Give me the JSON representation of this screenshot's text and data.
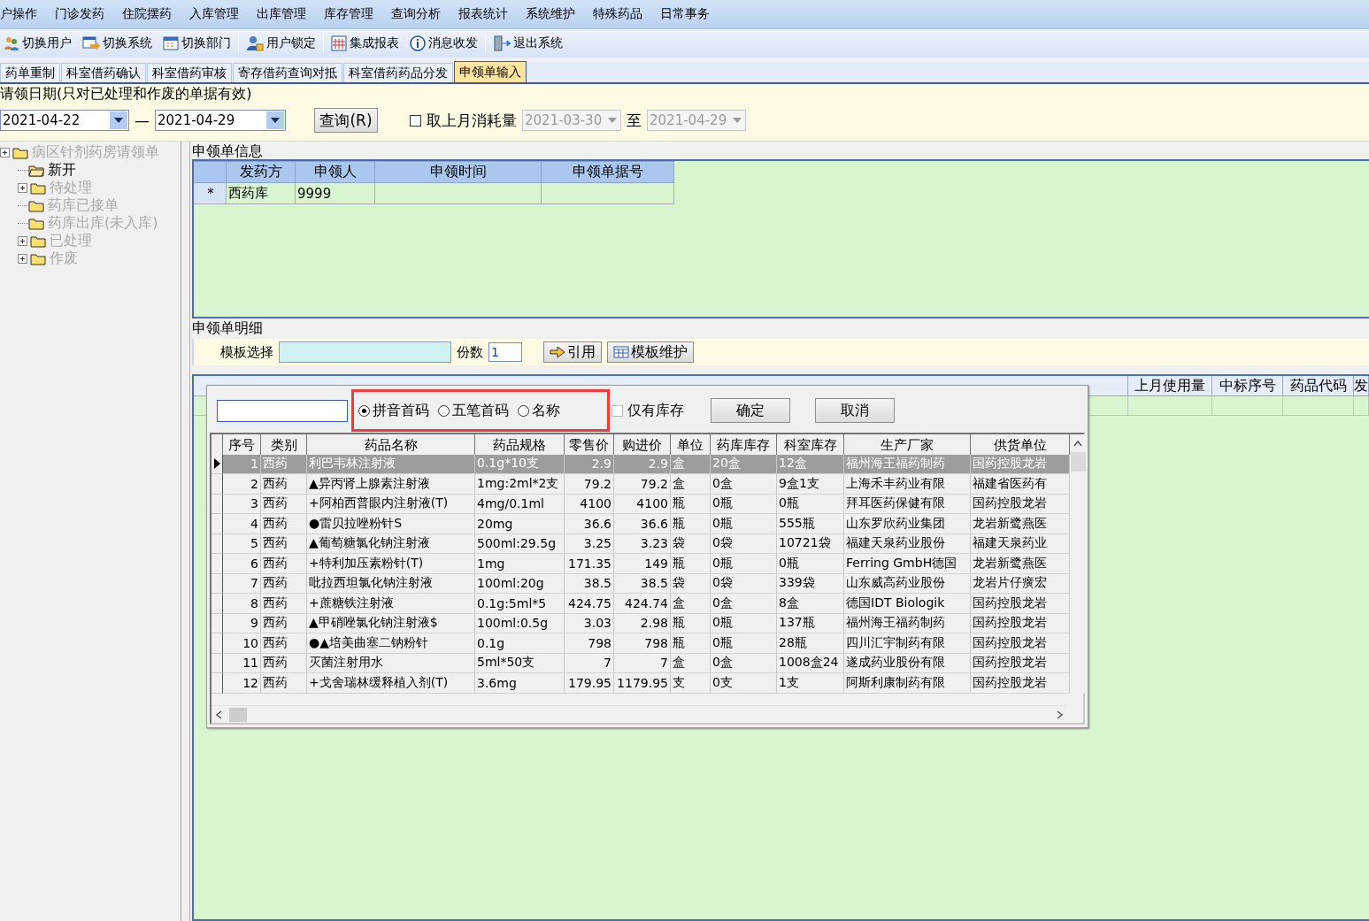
{
  "menu": [
    "户操作",
    "门诊发药",
    "住院摆药",
    "入库管理",
    "出库管理",
    "库存管理",
    "查询分析",
    "报表统计",
    "系统维护",
    "特殊药品",
    "日常事务"
  ],
  "toolbar": [
    "切换用户",
    "切换系统",
    "切换部门",
    "用户锁定",
    "集成报表",
    "消息收发",
    "退出系统"
  ],
  "tabs": [
    {
      "label": "药单重制",
      "selected": false
    },
    {
      "label": "科室借药确认",
      "selected": false
    },
    {
      "label": "科室借药审核",
      "selected": false
    },
    {
      "label": "寄存借药查询对抵",
      "selected": false
    },
    {
      "label": "科室借药药品分发",
      "selected": false
    },
    {
      "label": "申领单输入",
      "selected": true
    }
  ],
  "date_filter": {
    "label": "请领日期(只对已处理和作废的单据有效)",
    "from": "2021-04-22",
    "dash": "—",
    "to": "2021-04-29",
    "query_button": "查询(R)",
    "last_month": {
      "label": "取上月消耗量",
      "checked": false,
      "from": "2021-03-30",
      "to_label": "至",
      "to": "2021-04-29"
    }
  },
  "tree": {
    "label": "病区针剂药房请领单",
    "selected": false,
    "expandable": true,
    "children": [
      {
        "label": "新开",
        "selected": true,
        "expandable": false
      },
      {
        "label": "待处理",
        "selected": false,
        "expandable": true
      },
      {
        "label": "药库已接单",
        "selected": false,
        "expandable": false
      },
      {
        "label": "药库出库(未入库)",
        "selected": false,
        "expandable": false
      },
      {
        "label": "已处理",
        "selected": false,
        "expandable": true
      },
      {
        "label": "作废",
        "selected": false,
        "expandable": true
      }
    ]
  },
  "order_info": {
    "title": "申领单信息",
    "columns": [
      "发药方",
      "申领人",
      "申领时间",
      "申领单据号"
    ],
    "rows": [
      {
        "marker": "*",
        "cells": [
          "西药库",
          "9999"
        ]
      }
    ]
  },
  "detail": {
    "title": "申领单明细",
    "template_label": "模板选择",
    "copies_label": "份数",
    "copies": "1",
    "buttons": [
      "引用",
      "模板维护"
    ],
    "grid_columns": [
      "上月使用量",
      "中标序号",
      "药品代码",
      "发"
    ]
  },
  "picker": {
    "modes": [
      {
        "label": "拼音首码",
        "selected": true
      },
      {
        "label": "五笔首码",
        "selected": false
      },
      {
        "label": "名称",
        "selected": false
      }
    ],
    "in_stock": {
      "label": "仅有库存",
      "checked": false
    },
    "buttons": [
      "确定",
      "取消"
    ],
    "columns": [
      "序号",
      "类别",
      "药品名称",
      "药品规格",
      "零售价",
      "购进价",
      "单位",
      "药库库存",
      "科室库存",
      "生产厂家",
      "供货单位"
    ],
    "rows": [
      {
        "selected": true,
        "cells": [
          "1",
          "西药",
          "利巴韦林注射液",
          "0.1g*10支",
          "2.9",
          "2.9",
          "盒",
          "20盒",
          "12盒",
          "福州海王福药制药",
          "国药控股龙岩"
        ]
      },
      {
        "selected": false,
        "cells": [
          "2",
          "西药",
          "▲异丙肾上腺素注射液",
          "1mg:2ml*2支",
          "79.2",
          "79.2",
          "盒",
          "0盒",
          "9盒1支",
          "上海禾丰药业有限",
          "福建省医药有"
        ]
      },
      {
        "selected": false,
        "cells": [
          "3",
          "西药",
          "+阿柏西普眼内注射液(T)",
          "4mg/0.1ml",
          "4100",
          "4100",
          "瓶",
          "0瓶",
          "0瓶",
          "拜耳医药保健有限",
          "国药控股龙岩"
        ]
      },
      {
        "selected": false,
        "cells": [
          "4",
          "西药",
          "●雷贝拉唑粉针S",
          "20mg",
          "36.6",
          "36.6",
          "瓶",
          "0瓶",
          "555瓶",
          "山东罗欣药业集团",
          "龙岩新鹭燕医"
        ]
      },
      {
        "selected": false,
        "cells": [
          "5",
          "西药",
          "▲葡萄糖氯化钠注射液",
          "500ml:29.5g",
          "3.25",
          "3.23",
          "袋",
          "0袋",
          "10721袋",
          "福建天泉药业股份",
          "福建天泉药业"
        ]
      },
      {
        "selected": false,
        "cells": [
          "6",
          "西药",
          "+特利加压素粉针(T)",
          "1mg",
          "171.35",
          "149",
          "瓶",
          "0瓶",
          "0瓶",
          "Ferring GmbH德国",
          "龙岩新鹭燕医"
        ]
      },
      {
        "selected": false,
        "cells": [
          "7",
          "西药",
          "吡拉西坦氯化钠注射液",
          "100ml:20g",
          "38.5",
          "38.5",
          "袋",
          "0袋",
          "339袋",
          "山东威高药业股份",
          "龙岩片仔癀宏"
        ]
      },
      {
        "selected": false,
        "cells": [
          "8",
          "西药",
          "+蔗糖铁注射液",
          "0.1g:5ml*5",
          "424.75",
          "424.74",
          "盒",
          "0盒",
          "8盒",
          "德国IDT Biologik",
          "国药控股龙岩"
        ]
      },
      {
        "selected": false,
        "cells": [
          "9",
          "西药",
          "▲甲硝唑氯化钠注射液$",
          "100ml:0.5g",
          "3.03",
          "2.98",
          "瓶",
          "0瓶",
          "137瓶",
          "福州海王福药制药",
          "国药控股龙岩"
        ]
      },
      {
        "selected": false,
        "cells": [
          "10",
          "西药",
          "●▲培美曲塞二钠粉针",
          "0.1g",
          "798",
          "798",
          "瓶",
          "0瓶",
          "28瓶",
          "四川汇宇制药有限",
          "国药控股龙岩"
        ]
      },
      {
        "selected": false,
        "cells": [
          "11",
          "西药",
          "灭菌注射用水",
          "5ml*50支",
          "7",
          "7",
          "盒",
          "0盒",
          "1008盒24",
          "遂成药业股份有限",
          "国药控股龙岩"
        ]
      },
      {
        "selected": false,
        "cells": [
          "12",
          "西药",
          "+戈舍瑞林缓释植入剂(T)",
          "3.6mg",
          "179.95",
          "1179.95",
          "支",
          "0支",
          "1支",
          "阿斯利康制药有限",
          "国药控股龙岩"
        ]
      }
    ]
  }
}
